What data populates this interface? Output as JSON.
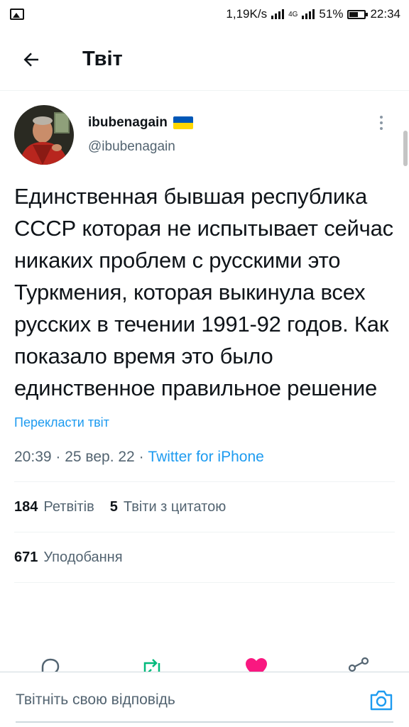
{
  "status_bar": {
    "speed": "1,19K/s",
    "network": "4G",
    "battery": "51%",
    "time": "22:34"
  },
  "header": {
    "title": "Твіт"
  },
  "tweet": {
    "display_name": "ibubenagain",
    "handle": "@ibubenagain",
    "text": "Единственная бывшая республика СССР которая не испытывает сейчас никаких проблем с русскими это Туркмения, которая выкинула всех русских в течении 1991-92 годов. Как показало время это было единственное правильное решение",
    "translate_label": "Перекласти твіт",
    "time": "20:39",
    "date": "25 вер. 22",
    "source": "Twitter for iPhone",
    "retweets_count": "184",
    "retweets_label": "Ретвітів",
    "quotes_count": "5",
    "quotes_label": "Твіти з цитатою",
    "likes_count": "671",
    "likes_label": "Уподобання"
  },
  "reply": {
    "placeholder": "Твітніть свою відповідь"
  },
  "colors": {
    "accent": "#1d9bf0",
    "retweet": "#00ba7c",
    "like": "#f91880",
    "secondary_text": "#536471"
  }
}
